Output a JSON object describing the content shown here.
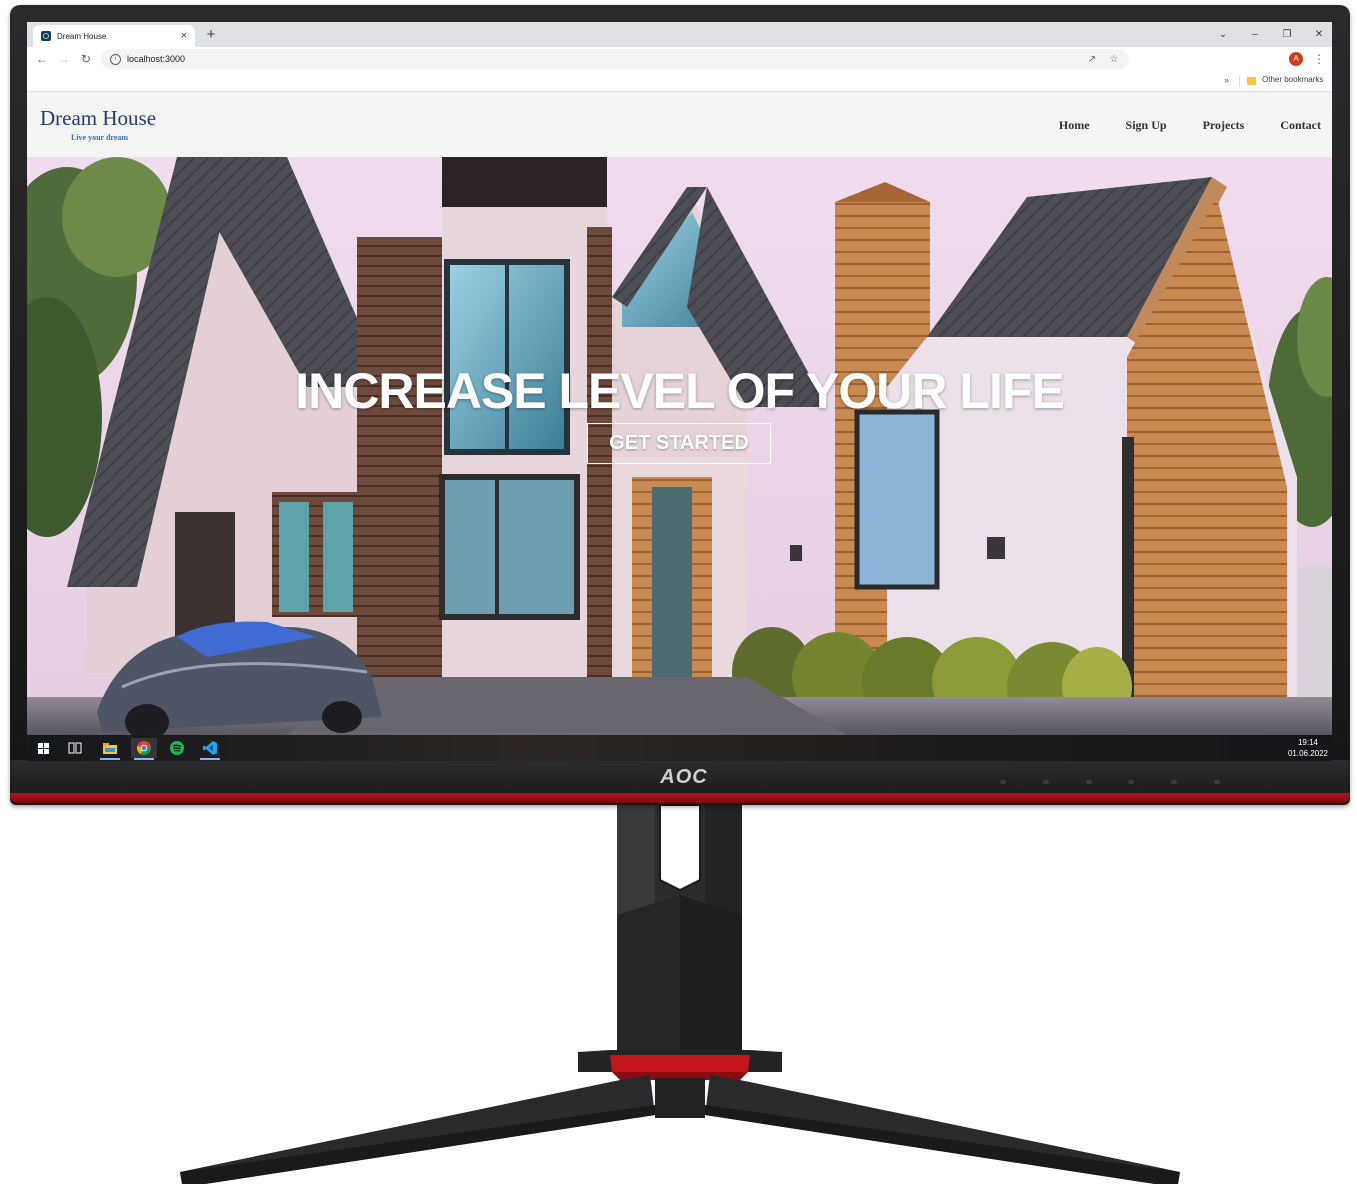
{
  "browser": {
    "tab_title": "Dream House",
    "tab_close": "×",
    "new_tab": "+",
    "url": "localhost:3000",
    "profile_initial": "A",
    "bookmarks_overflow": "»",
    "bookmarks_folder": "Other bookmarks",
    "window_controls": [
      "⌄",
      "–",
      "❐",
      "✕"
    ]
  },
  "site": {
    "brand": "Dream House",
    "tagline": "Live your dream",
    "nav": [
      "Home",
      "Sign Up",
      "Projects",
      "Contact"
    ],
    "hero_title": "INCREASE LEVEL OF YOUR LIFE",
    "hero_button": "GET STARTED"
  },
  "taskbar": {
    "items": [
      "windows-start-icon",
      "task-view-icon",
      "file-explorer-icon",
      "chrome-icon",
      "spotify-icon",
      "vscode-icon"
    ],
    "time": "19:14",
    "date": "01.06.2022"
  },
  "monitor": {
    "brand": "AOC"
  },
  "colors": {
    "brand_text": "#243a6e",
    "tagline": "#3572b5",
    "accent_red": "#b3121b"
  }
}
